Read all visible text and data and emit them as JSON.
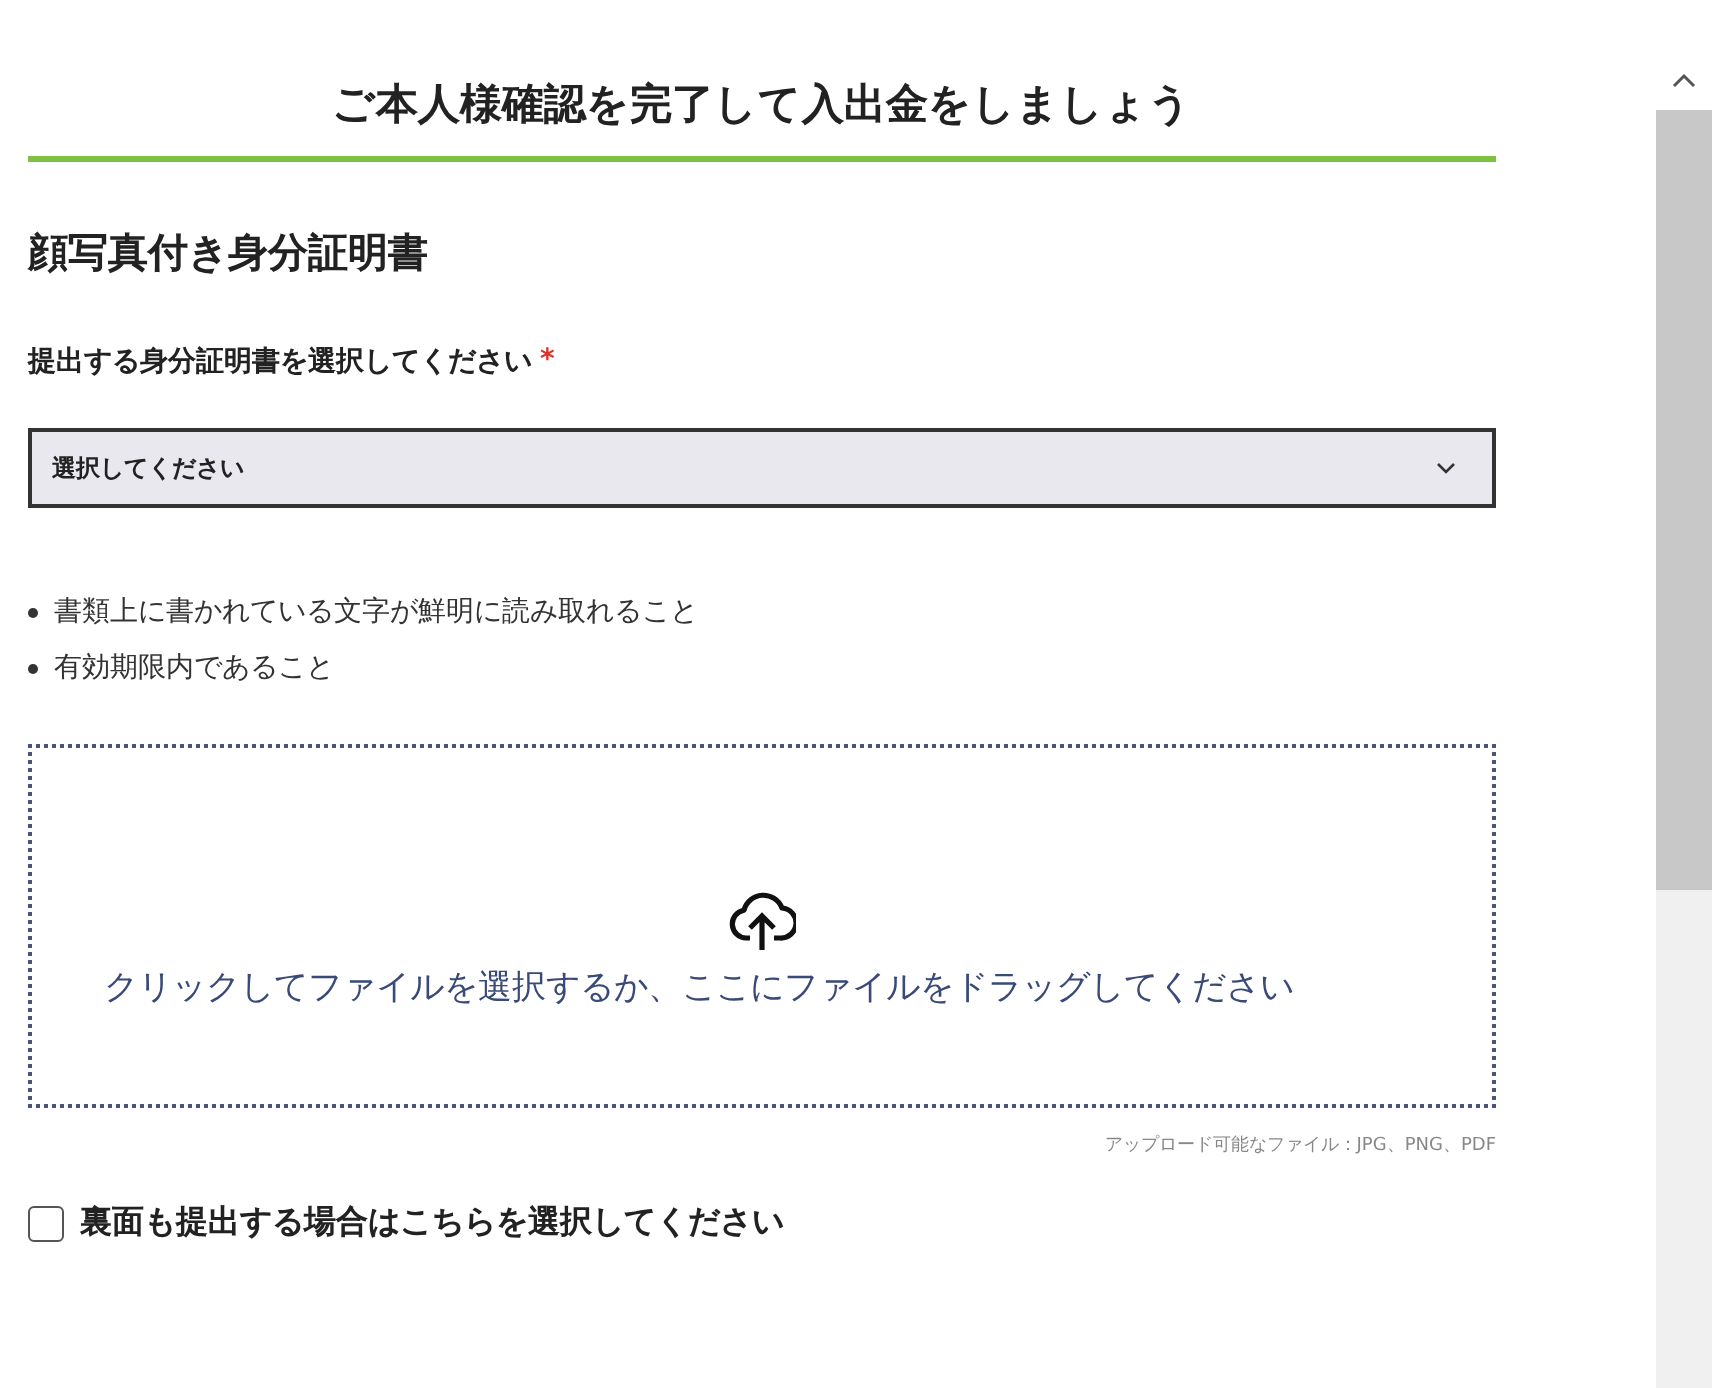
{
  "page_title": "ご本人様確認を完了して入出金をしましょう",
  "section_title": "顔写真付き身分証明書",
  "document_select": {
    "label": "提出する身分証明書を選択してください",
    "required_mark": "*",
    "value": "選択してください"
  },
  "requirements": [
    "書類上に書かれている文字が鮮明に読み取れること",
    "有効期限内であること"
  ],
  "upload": {
    "prompt": "クリックしてファイルを選択するか、ここにファイルをドラッグしてください",
    "allowed_types": "アップロード可能なファイル：JPG、PNG、PDF"
  },
  "back_side_checkbox": {
    "label": "裏面も提出する場合はこちらを選択してください",
    "checked": false
  }
}
